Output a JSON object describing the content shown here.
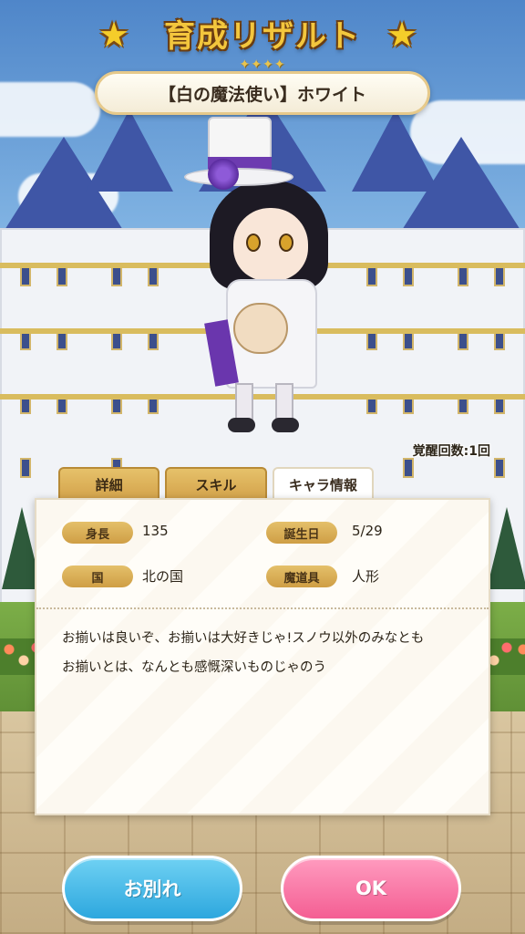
{
  "header": {
    "title": "育成リザルト",
    "rarity": "✦✦✦✦",
    "character_name": "【白の魔法使い】ホワイト"
  },
  "awaken_count": "覚醒回数:1回",
  "tabs": [
    {
      "label": "詳細",
      "active": false
    },
    {
      "label": "スキル",
      "active": false
    },
    {
      "label": "キャラ情報",
      "active": true
    }
  ],
  "profile": {
    "height_label": "身長",
    "height_value": "135",
    "birthday_label": "誕生日",
    "birthday_value": "5/29",
    "country_label": "国",
    "country_value": "北の国",
    "tool_label": "魔道具",
    "tool_value": "人形"
  },
  "message": {
    "line1": "お揃いは良いぞ、お揃いは大好きじゃ!スノウ以外のみなとも",
    "line2": "お揃いとは、なんとも感慨深いものじゃのう"
  },
  "buttons": {
    "farewell_label": "お別れ",
    "ok_label": "OK"
  },
  "colors": {
    "farewell_button": "#2da7de",
    "ok_button": "#f45e93",
    "gold": "#d9bc5e"
  }
}
